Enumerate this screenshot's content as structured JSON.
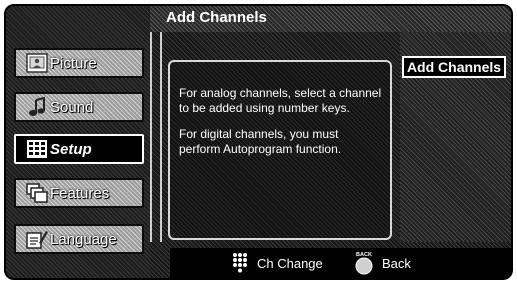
{
  "sidebar": {
    "items": [
      {
        "label": "Picture",
        "icon": "picture-icon",
        "selected": false
      },
      {
        "label": "Sound",
        "icon": "sound-icon",
        "selected": false
      },
      {
        "label": "Setup",
        "icon": "setup-icon",
        "selected": true
      },
      {
        "label": "Features",
        "icon": "features-icon",
        "selected": false
      },
      {
        "label": "Language",
        "icon": "language-icon",
        "selected": false
      }
    ]
  },
  "header": {
    "title": "Add Channels"
  },
  "main": {
    "info": [
      "For analog channels, select a channel to be added using number keys.",
      "For digital channels, you must perform Autoprogram function."
    ],
    "option_button": "Add Channels"
  },
  "footer": {
    "hints": [
      {
        "icon": "numpad-icon",
        "label": "Ch Change"
      },
      {
        "icon": "back-button-icon",
        "label": "Back",
        "icon_text": "BACK"
      }
    ]
  }
}
